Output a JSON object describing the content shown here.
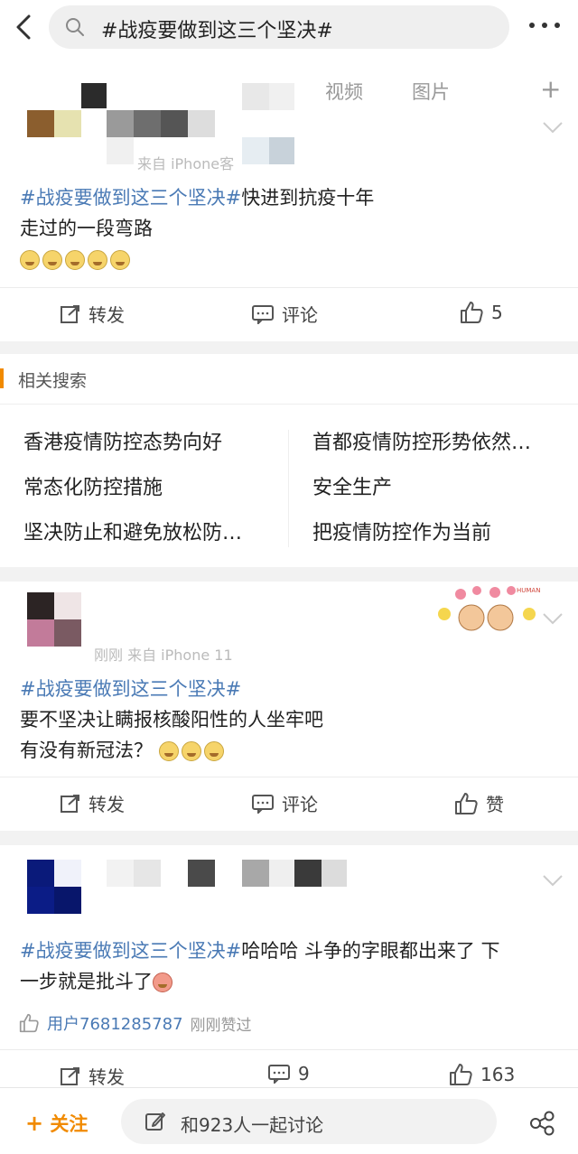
{
  "search": {
    "query": "#战疫要做到这三个坚决#"
  },
  "overlay_tabs": {
    "video": "视频",
    "picture": "图片",
    "add": "+"
  },
  "posts": [
    {
      "hashtag": "#战疫要做到这三个坚决#",
      "text_after_tag": "快进到抗疫十年",
      "text_line2": "走过的一段弯路",
      "source_hint": "来自 iPhone客",
      "actions": {
        "repost": "转发",
        "comment": "评论",
        "like": "5"
      }
    },
    {
      "hashtag": "#战疫要做到这三个坚决#",
      "text_line2": "要不坚决让瞒报核酸阳性的人坐牢吧",
      "text_line3": "有没有新冠法？",
      "source_hint": "刚刚 来自 iPhone 11",
      "sticker_label": "HUMAN",
      "actions": {
        "repost": "转发",
        "comment": "评论",
        "like": "赞"
      }
    },
    {
      "hashtag": "#战疫要做到这三个坚决#",
      "text_after_tag": "哈哈哈 斗争的字眼都出来了 下",
      "text_line2": "一步就是批斗了",
      "liker": "用户7681285787",
      "liked_note": "刚刚赞过",
      "actions": {
        "repost": "转发",
        "comment": "9",
        "like": "163"
      }
    }
  ],
  "related": {
    "title": "相关搜索",
    "items": [
      "香港疫情防控态势向好",
      "首都疫情防控形势依然…",
      "常态化防控措施",
      "安全生产",
      "坚决防止和避免放松防…",
      "把疫情防控作为当前"
    ]
  },
  "bottom": {
    "follow": "关注",
    "follow_plus": "+",
    "discuss": "和923人一起讨论"
  },
  "colors": {
    "accent": "#f18a00",
    "hashtag": "#4a7ab5",
    "background": "#f2f2f2"
  }
}
